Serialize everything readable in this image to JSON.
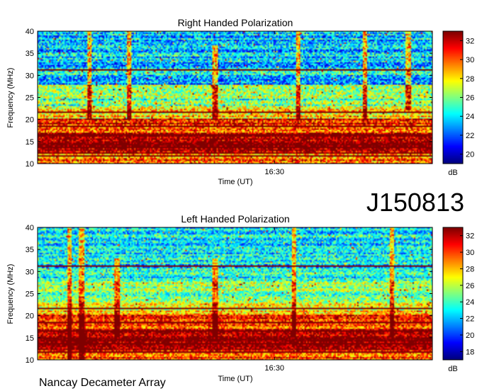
{
  "figure": {
    "event_id": "J150813",
    "observatory": "Nancay Decameter Array"
  },
  "chart_data": [
    {
      "type": "heatmap",
      "title": "Right Handed Polarization",
      "xlabel": "Time (UT)",
      "ylabel": "Frequency (MHz)",
      "x_ticks": [
        "16:30"
      ],
      "y_ticks": [
        10,
        15,
        20,
        25,
        30,
        35,
        40
      ],
      "ylim": [
        10,
        40
      ],
      "colorbar": {
        "label": "dB",
        "ticks": [
          20,
          22,
          24,
          26,
          28,
          30,
          32
        ],
        "range": [
          19,
          33
        ],
        "colormap": "jet"
      },
      "bands": [
        {
          "freq_range": [
            10,
            12
          ],
          "level_db": 30
        },
        {
          "freq_range": [
            12,
            17
          ],
          "level_db": 33
        },
        {
          "freq_range": [
            17,
            20
          ],
          "level_db": 31
        },
        {
          "freq_range": [
            20,
            23
          ],
          "level_db": 28
        },
        {
          "freq_range": [
            23,
            28
          ],
          "level_db": 25.5
        },
        {
          "freq_range": [
            28,
            40
          ],
          "level_db": 23.5
        }
      ],
      "horizontal_lines_mhz": [
        31.3,
        21.5,
        18.5,
        16.5,
        13.5,
        11.5
      ],
      "features": [
        {
          "time_frac": 0.13,
          "freq_range": [
            20,
            40
          ]
        },
        {
          "time_frac": 0.23,
          "freq_range": [
            20,
            40
          ]
        },
        {
          "time_frac": 0.45,
          "freq_range": [
            20,
            37
          ]
        },
        {
          "time_frac": 0.66,
          "freq_range": [
            20,
            40
          ]
        },
        {
          "time_frac": 0.83,
          "freq_range": [
            20,
            40
          ]
        },
        {
          "time_frac": 0.94,
          "freq_range": [
            22,
            40
          ]
        }
      ]
    },
    {
      "type": "heatmap",
      "title": "Left Handed Polarization",
      "xlabel": "Time (UT)",
      "ylabel": "Frequency (MHz)",
      "x_ticks": [
        "16:30"
      ],
      "y_ticks": [
        10,
        15,
        20,
        25,
        30,
        35,
        40
      ],
      "ylim": [
        10,
        40
      ],
      "colorbar": {
        "label": "dB",
        "ticks": [
          18,
          20,
          22,
          24,
          26,
          28,
          30,
          32
        ],
        "range": [
          17,
          33
        ],
        "colormap": "jet"
      },
      "bands": [
        {
          "freq_range": [
            10,
            12
          ],
          "level_db": 30
        },
        {
          "freq_range": [
            12,
            17
          ],
          "level_db": 33
        },
        {
          "freq_range": [
            17,
            20
          ],
          "level_db": 30
        },
        {
          "freq_range": [
            20,
            23
          ],
          "level_db": 27
        },
        {
          "freq_range": [
            23,
            28
          ],
          "level_db": 25
        },
        {
          "freq_range": [
            28,
            40
          ],
          "level_db": 23
        }
      ],
      "horizontal_lines_mhz": [
        31.3,
        21.5,
        18.5,
        16.5,
        13.5,
        11.5
      ],
      "features": [
        {
          "time_frac": 0.08,
          "freq_range": [
            10,
            40
          ]
        },
        {
          "time_frac": 0.11,
          "freq_range": [
            10,
            40
          ]
        },
        {
          "time_frac": 0.2,
          "freq_range": [
            15,
            33
          ]
        },
        {
          "time_frac": 0.45,
          "freq_range": [
            15,
            33
          ]
        },
        {
          "time_frac": 0.65,
          "freq_range": [
            15,
            40
          ]
        },
        {
          "time_frac": 0.9,
          "freq_range": [
            15,
            40
          ]
        }
      ]
    }
  ]
}
